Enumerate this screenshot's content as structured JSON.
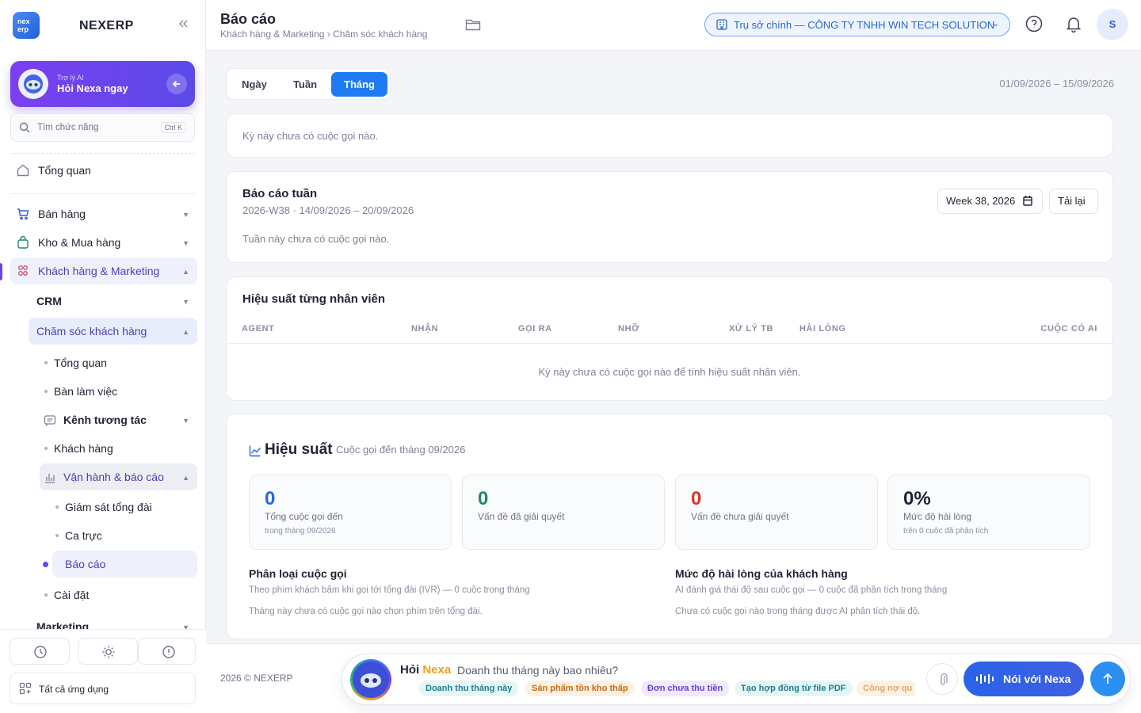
{
  "app": {
    "name": "NEXERP",
    "logo_text": "nex erp"
  },
  "ai_card": {
    "subtitle": "Trợ lý AI",
    "title": "Hỏi Nexa ngay"
  },
  "search": {
    "placeholder": "Tìm chức năng",
    "shortcut": "Ctrl K"
  },
  "sidebar": {
    "overview": "Tổng quan",
    "sales": "Bán hàng",
    "stock": "Kho & Mua hàng",
    "crm_marketing": "Khách hàng & Marketing",
    "crm": "CRM",
    "care": "Chăm sóc khách hàng",
    "care_overview": "Tổng quan",
    "workspace": "Bàn làm việc",
    "channels": "Kênh tương tác",
    "customers": "Khách hàng",
    "ops_reports": "Vận hành & báo cáo",
    "monitor": "Giám sát tổng đài",
    "shifts": "Ca trực",
    "reports": "Báo cáo",
    "settings": "Cài đặt",
    "marketing": "Marketing",
    "all_apps": "Tất cả ứng dụng"
  },
  "header": {
    "title": "Báo cáo",
    "breadcrumb": "Khách hàng & Marketing › Chăm sóc khách hàng",
    "company": "Trụ sở chính — CÔNG TY TNHH WIN TECH SOLUTION",
    "avatar": "S"
  },
  "period": {
    "tabs": [
      "Ngày",
      "Tuần",
      "Tháng"
    ],
    "active": "Tháng",
    "range": "01/09/2026 – 15/09/2026"
  },
  "empty_period": "Kỳ này chưa có cuộc gọi nào.",
  "weekly": {
    "title": "Báo cáo tuần",
    "subtitle": "2026-W38 · 14/09/2026 – 20/09/2026",
    "week_value": "Week 38, 2026",
    "reload": "Tải lại",
    "empty": "Tuần này chưa có cuộc gọi nào."
  },
  "agents": {
    "title": "Hiệu suất từng nhân viên",
    "columns": [
      "AGENT",
      "NHẬN",
      "GỌI RA",
      "NHỠ",
      "XỬ LÝ TB",
      "HÀI LÒNG",
      "CUỘC CÓ AI"
    ],
    "empty": "Kỳ này chưa có cuộc gọi nào để tính hiệu suất nhân viên."
  },
  "performance": {
    "title": "Hiệu suất",
    "subtitle": "Cuộc gọi đến tháng 09/2026",
    "stats": [
      {
        "value": "0",
        "label": "Tổng cuộc gọi đến",
        "sub": "trong tháng 09/2026",
        "color": "#2a63e8"
      },
      {
        "value": "0",
        "label": "Vấn đề đã giải quyết",
        "sub": "",
        "color": "#1f8a5c"
      },
      {
        "value": "0",
        "label": "Vấn đề chưa giải quyết",
        "sub": "",
        "color": "#d9342b"
      },
      {
        "value": "0%",
        "label": "Mức độ hài lòng",
        "sub": "trên 0 cuộc đã phân tích",
        "color": "#1f2433"
      }
    ],
    "classify": {
      "title": "Phân loại cuộc gọi",
      "desc": "Theo phím khách bấm khi gọi tới tổng đài (IVR) — 0 cuộc trong tháng",
      "empty": "Tháng này chưa có cuộc gọi nào chọn phím trên tổng đài."
    },
    "satisfaction": {
      "title": "Mức độ hài lòng của khách hàng",
      "desc": "AI đánh giá thái độ sau cuộc gọi — 0 cuộc đã phân tích trong tháng",
      "empty": "Chưa có cuộc gọi nào trong tháng được AI phân tích thái độ."
    }
  },
  "footer": {
    "copyright": "2026 © NEXERP"
  },
  "ask": {
    "prefix": "Hỏi",
    "brand": "Nexa",
    "placeholder": "Doanh thu tháng này bao nhiêu?",
    "chips": [
      "Doanh thu tháng này",
      "Sản phẩm tồn kho thấp",
      "Đơn chưa thu tiền",
      "Tạo hợp đồng từ file PDF",
      "Công nợ qu"
    ],
    "talk": "Nói với Nexa"
  }
}
